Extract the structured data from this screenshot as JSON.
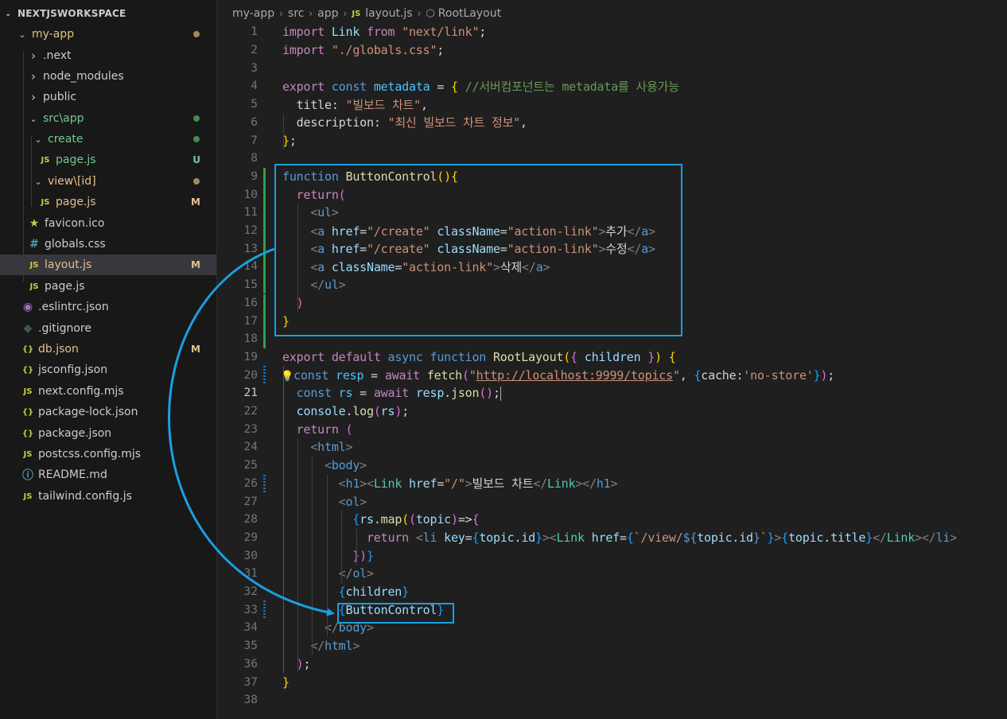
{
  "explorer": {
    "workspace_title": "NEXTJSWORKSPACE",
    "items": [
      {
        "label": "my-app",
        "kind": "folder-open",
        "color": "yellow",
        "dot": "#9e8a5b"
      },
      {
        "label": ".next",
        "kind": "folder-closed"
      },
      {
        "label": "node_modules",
        "kind": "folder-closed"
      },
      {
        "label": "public",
        "kind": "folder-closed"
      },
      {
        "label": "src\\app",
        "kind": "folder-open",
        "color": "green",
        "dot": "#3f8a57"
      },
      {
        "label": "create",
        "kind": "folder-open",
        "color": "green",
        "dot": "#3f8a57"
      },
      {
        "label": "page.js",
        "kind": "js",
        "color": "green",
        "badge": "U"
      },
      {
        "label": "view\\[id]",
        "kind": "folder-open",
        "color": "yellow",
        "dot": "#9e8a5b"
      },
      {
        "label": "page.js",
        "kind": "js",
        "color": "yellow",
        "badge": "M"
      },
      {
        "label": "favicon.ico",
        "kind": "favicon"
      },
      {
        "label": "globals.css",
        "kind": "css"
      },
      {
        "label": "layout.js",
        "kind": "js",
        "color": "yellow",
        "badge": "M",
        "selected": true
      },
      {
        "label": "page.js",
        "kind": "js"
      },
      {
        "label": ".eslintrc.json",
        "kind": "eslint"
      },
      {
        "label": ".gitignore",
        "kind": "git"
      },
      {
        "label": "db.json",
        "kind": "json",
        "color": "yellow",
        "badge": "M"
      },
      {
        "label": "jsconfig.json",
        "kind": "json"
      },
      {
        "label": "next.config.mjs",
        "kind": "js"
      },
      {
        "label": "package-lock.json",
        "kind": "json"
      },
      {
        "label": "package.json",
        "kind": "json"
      },
      {
        "label": "postcss.config.mjs",
        "kind": "js"
      },
      {
        "label": "README.md",
        "kind": "info"
      },
      {
        "label": "tailwind.config.js",
        "kind": "js"
      }
    ]
  },
  "breadcrumb": {
    "parts": [
      "my-app",
      "src",
      "app",
      "layout.js",
      "RootLayout"
    ],
    "file_icon": "JS"
  },
  "editor": {
    "active_line": 21,
    "lines": [
      {
        "n": 1,
        "tokens": [
          [
            "import ",
            "ct"
          ],
          [
            "Link ",
            "vr"
          ],
          [
            "from ",
            "ct"
          ],
          [
            "\"next/link\"",
            "st"
          ],
          [
            ";",
            ""
          ]
        ]
      },
      {
        "n": 2,
        "tokens": [
          [
            "import ",
            "ct"
          ],
          [
            "\"./globals.css\"",
            "st"
          ],
          [
            ";",
            ""
          ]
        ]
      },
      {
        "n": 3,
        "tokens": []
      },
      {
        "n": 4,
        "tokens": [
          [
            "export ",
            "ct"
          ],
          [
            "const ",
            "kw"
          ],
          [
            "metadata ",
            "cn"
          ],
          [
            "= ",
            ""
          ],
          [
            "{ ",
            "b1"
          ],
          [
            "//서버컴포넌트는 metadata를 사용가능",
            "cm"
          ]
        ]
      },
      {
        "n": 5,
        "tokens": [
          [
            "  title",
            ""
          ],
          [
            ": ",
            ""
          ],
          [
            "\"빌보드 차트\"",
            "st"
          ],
          [
            ",",
            ""
          ]
        ]
      },
      {
        "n": 6,
        "tokens": [
          [
            "  description",
            ""
          ],
          [
            ": ",
            ""
          ],
          [
            "\"최신 빌보드 차트 정보\"",
            "st"
          ],
          [
            ",",
            ""
          ]
        ]
      },
      {
        "n": 7,
        "tokens": [
          [
            "}",
            "b1"
          ],
          [
            ";",
            ""
          ]
        ]
      },
      {
        "n": 8,
        "tokens": []
      },
      {
        "n": 9,
        "gutter": "add",
        "tokens": [
          [
            "function ",
            "kw"
          ],
          [
            "ButtonControl",
            "fn"
          ],
          [
            "()",
            "b1"
          ],
          [
            "{",
            "b1"
          ]
        ]
      },
      {
        "n": 10,
        "gutter": "add",
        "tokens": [
          [
            "  return",
            "ct"
          ],
          [
            "(",
            "b2"
          ]
        ]
      },
      {
        "n": 11,
        "gutter": "add",
        "tokens": [
          [
            "    <",
            "ta"
          ],
          [
            "ul",
            "tg"
          ],
          [
            ">",
            "ta"
          ]
        ]
      },
      {
        "n": 12,
        "gutter": "add",
        "tokens": [
          [
            "    <",
            "ta"
          ],
          [
            "a ",
            "tg"
          ],
          [
            "href",
            "at"
          ],
          [
            "=",
            ""
          ],
          [
            "\"/create\" ",
            "st"
          ],
          [
            "className",
            "at"
          ],
          [
            "=",
            ""
          ],
          [
            "\"action-link\"",
            "st"
          ],
          [
            ">",
            "ta"
          ],
          [
            "추가",
            ""
          ],
          [
            "</",
            "ta"
          ],
          [
            "a",
            "tg"
          ],
          [
            ">",
            "ta"
          ]
        ]
      },
      {
        "n": 13,
        "gutter": "add",
        "tokens": [
          [
            "    <",
            "ta"
          ],
          [
            "a ",
            "tg"
          ],
          [
            "href",
            "at"
          ],
          [
            "=",
            ""
          ],
          [
            "\"/create\" ",
            "st"
          ],
          [
            "className",
            "at"
          ],
          [
            "=",
            ""
          ],
          [
            "\"action-link\"",
            "st"
          ],
          [
            ">",
            "ta"
          ],
          [
            "수정",
            ""
          ],
          [
            "</",
            "ta"
          ],
          [
            "a",
            "tg"
          ],
          [
            ">",
            "ta"
          ]
        ]
      },
      {
        "n": 14,
        "gutter": "add",
        "tokens": [
          [
            "    <",
            "ta"
          ],
          [
            "a ",
            "tg"
          ],
          [
            "className",
            "at"
          ],
          [
            "=",
            ""
          ],
          [
            "\"action-link\"",
            "st"
          ],
          [
            ">",
            "ta"
          ],
          [
            "삭제",
            ""
          ],
          [
            "</",
            "ta"
          ],
          [
            "a",
            "tg"
          ],
          [
            ">",
            "ta"
          ]
        ]
      },
      {
        "n": 15,
        "gutter": "add",
        "tokens": [
          [
            "    </",
            "ta"
          ],
          [
            "ul",
            "tg"
          ],
          [
            ">",
            "ta"
          ]
        ]
      },
      {
        "n": 16,
        "gutter": "add",
        "tokens": [
          [
            "  )",
            "b2"
          ]
        ]
      },
      {
        "n": 17,
        "gutter": "add",
        "tokens": [
          [
            "}",
            "b1"
          ]
        ]
      },
      {
        "n": 18,
        "gutter": "add",
        "tokens": []
      },
      {
        "n": 19,
        "tokens": [
          [
            "export ",
            "ct"
          ],
          [
            "default ",
            "ct"
          ],
          [
            "async ",
            "kw"
          ],
          [
            "function ",
            "kw"
          ],
          [
            "RootLayout",
            "fn"
          ],
          [
            "(",
            "b1"
          ],
          [
            "{ ",
            "b2"
          ],
          [
            "children ",
            "vr"
          ],
          [
            "}",
            "b2"
          ],
          [
            ") ",
            "b1"
          ],
          [
            "{",
            "b1"
          ]
        ]
      },
      {
        "n": 20,
        "gutter": "mod",
        "bulb": true,
        "tokens": [
          [
            "const ",
            "kw"
          ],
          [
            "resp ",
            "cn"
          ],
          [
            "= ",
            ""
          ],
          [
            "await ",
            "ct"
          ],
          [
            "fetch",
            "fn"
          ],
          [
            "(",
            "b2"
          ],
          [
            "\"",
            "st"
          ],
          [
            "http://localhost:9999/topics",
            "st ul"
          ],
          [
            "\"",
            "st"
          ],
          [
            ", ",
            ""
          ],
          [
            "{",
            "b3"
          ],
          [
            "cache",
            ""
          ],
          [
            ":",
            ""
          ],
          [
            "'no-store'",
            "st"
          ],
          [
            "}",
            "b3"
          ],
          [
            ")",
            "b2"
          ],
          [
            ";",
            ""
          ]
        ]
      },
      {
        "n": 21,
        "tokens": [
          [
            "  const ",
            "kw"
          ],
          [
            "rs ",
            "cn"
          ],
          [
            "= ",
            ""
          ],
          [
            "await ",
            "ct"
          ],
          [
            "resp",
            "vr"
          ],
          [
            ".",
            ""
          ],
          [
            "json",
            "fn"
          ],
          [
            "()",
            "b2"
          ],
          [
            ";",
            ""
          ]
        ]
      },
      {
        "n": 22,
        "tokens": [
          [
            "  console",
            "vr"
          ],
          [
            ".",
            ""
          ],
          [
            "log",
            "fn"
          ],
          [
            "(",
            "b2"
          ],
          [
            "rs",
            "vr"
          ],
          [
            ")",
            "b2"
          ],
          [
            ";",
            ""
          ]
        ]
      },
      {
        "n": 23,
        "tokens": [
          [
            "  return ",
            "ct"
          ],
          [
            "(",
            "b2"
          ]
        ]
      },
      {
        "n": 24,
        "tokens": [
          [
            "    <",
            "ta"
          ],
          [
            "html",
            "tg"
          ],
          [
            ">",
            "ta"
          ]
        ]
      },
      {
        "n": 25,
        "tokens": [
          [
            "      <",
            "ta"
          ],
          [
            "body",
            "tg"
          ],
          [
            ">",
            "ta"
          ]
        ]
      },
      {
        "n": 26,
        "gutter": "mod",
        "tokens": [
          [
            "        <",
            "ta"
          ],
          [
            "h1",
            "tg"
          ],
          [
            "><",
            "ta"
          ],
          [
            "Link ",
            "cp"
          ],
          [
            "href",
            "at"
          ],
          [
            "=",
            ""
          ],
          [
            "\"/\"",
            "st"
          ],
          [
            ">",
            "ta"
          ],
          [
            "빌보드 차트",
            ""
          ],
          [
            "</",
            "ta"
          ],
          [
            "Link",
            "cp"
          ],
          [
            "></",
            "ta"
          ],
          [
            "h1",
            "tg"
          ],
          [
            ">",
            "ta"
          ]
        ]
      },
      {
        "n": 27,
        "tokens": [
          [
            "        <",
            "ta"
          ],
          [
            "ol",
            "tg"
          ],
          [
            ">",
            "ta"
          ]
        ]
      },
      {
        "n": 28,
        "tokens": [
          [
            "          {",
            "b3"
          ],
          [
            "rs",
            "vr"
          ],
          [
            ".",
            ""
          ],
          [
            "map",
            "fn"
          ],
          [
            "(",
            "b1"
          ],
          [
            "(",
            "b2"
          ],
          [
            "topic",
            "vr"
          ],
          [
            ")",
            "b2"
          ],
          [
            "=>",
            ""
          ],
          [
            "{",
            "b2"
          ]
        ]
      },
      {
        "n": 29,
        "tokens": [
          [
            "            return ",
            "ct"
          ],
          [
            "<",
            "ta"
          ],
          [
            "li ",
            "tg"
          ],
          [
            "key",
            "at"
          ],
          [
            "=",
            ""
          ],
          [
            "{",
            "b3"
          ],
          [
            "topic",
            "vr"
          ],
          [
            ".",
            ""
          ],
          [
            "id",
            "vr"
          ],
          [
            "}",
            "b3"
          ],
          [
            "><",
            "ta"
          ],
          [
            "Link ",
            "cp"
          ],
          [
            "href",
            "at"
          ],
          [
            "=",
            ""
          ],
          [
            "{",
            "b3"
          ],
          [
            "`/view/",
            "st"
          ],
          [
            "${",
            "kw"
          ],
          [
            "topic",
            "vr"
          ],
          [
            ".",
            ""
          ],
          [
            "id",
            "vr"
          ],
          [
            "}",
            "kw"
          ],
          [
            "`",
            "st"
          ],
          [
            "}",
            "b3"
          ],
          [
            ">",
            "ta"
          ],
          [
            "{",
            "b3"
          ],
          [
            "topic",
            "vr"
          ],
          [
            ".",
            ""
          ],
          [
            "title",
            "vr"
          ],
          [
            "}",
            "b3"
          ],
          [
            "</",
            "ta"
          ],
          [
            "Link",
            "cp"
          ],
          [
            "></",
            "ta"
          ],
          [
            "li",
            "tg"
          ],
          [
            ">",
            "ta"
          ]
        ]
      },
      {
        "n": 30,
        "tokens": [
          [
            "          })",
            "b2"
          ],
          [
            "}",
            "b3"
          ]
        ]
      },
      {
        "n": 31,
        "tokens": [
          [
            "        </",
            "ta"
          ],
          [
            "ol",
            "tg"
          ],
          [
            ">",
            "ta"
          ]
        ]
      },
      {
        "n": 32,
        "tokens": [
          [
            "        {",
            "b3"
          ],
          [
            "children",
            "vr"
          ],
          [
            "}",
            "b3"
          ]
        ]
      },
      {
        "n": 33,
        "gutter": "mod",
        "tokens": [
          [
            "        {",
            "b3"
          ],
          [
            "ButtonControl",
            "vr"
          ],
          [
            "}",
            "b3"
          ]
        ]
      },
      {
        "n": 34,
        "tokens": [
          [
            "      </",
            "ta"
          ],
          [
            "body",
            "tg"
          ],
          [
            ">",
            "ta"
          ]
        ]
      },
      {
        "n": 35,
        "tokens": [
          [
            "    </",
            "ta"
          ],
          [
            "html",
            "tg"
          ],
          [
            ">",
            "ta"
          ]
        ]
      },
      {
        "n": 36,
        "tokens": [
          [
            "  )",
            "b2"
          ],
          [
            ";",
            ""
          ]
        ]
      },
      {
        "n": 37,
        "tokens": [
          [
            "}",
            "b1"
          ]
        ]
      },
      {
        "n": 38,
        "tokens": []
      }
    ]
  },
  "annotation": {
    "color": "#1a9fe0"
  }
}
